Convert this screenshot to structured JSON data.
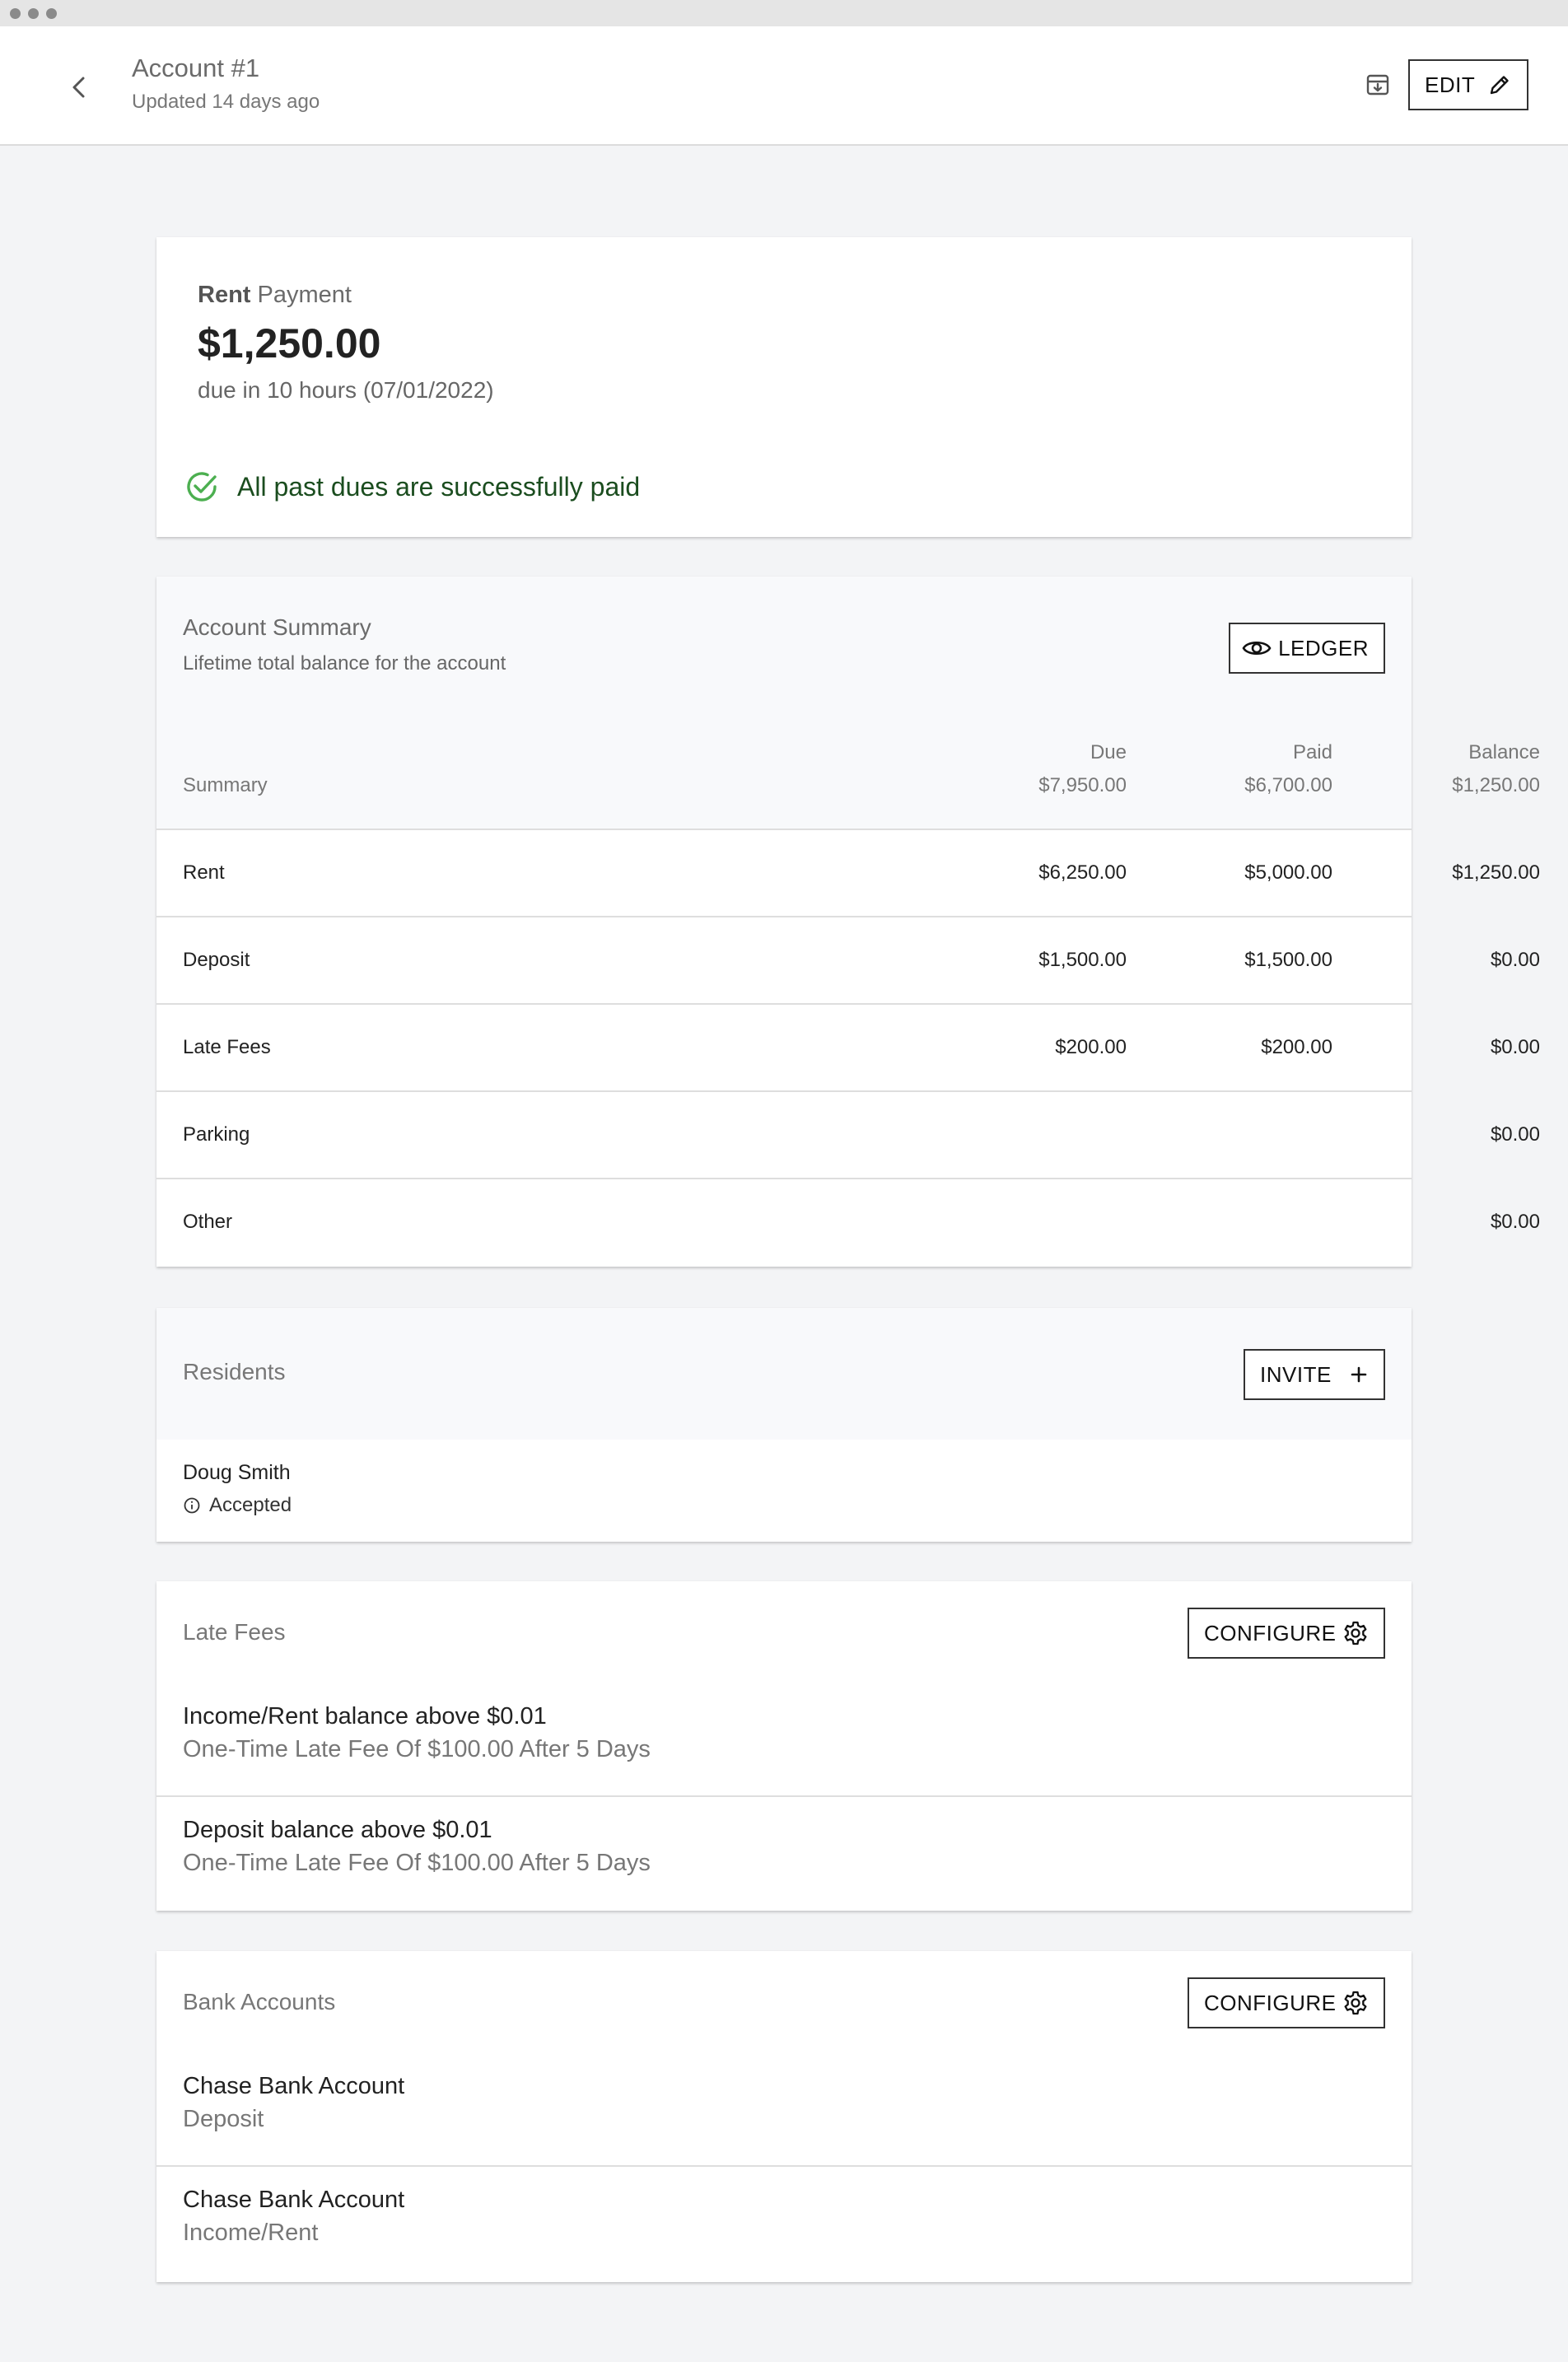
{
  "header": {
    "title": "Account #1",
    "updated": "Updated 14 days ago",
    "edit_label": "EDIT"
  },
  "payment": {
    "type_bold": "Rent",
    "type_rest": " Payment",
    "amount": "$1,250.00",
    "due": "due in 10 hours (07/01/2022)",
    "status": "All past dues are successfully paid"
  },
  "summary": {
    "title": "Account Summary",
    "subtitle": "Lifetime total balance for the account",
    "ledger_label": "LEDGER",
    "columns": {
      "summary": "Summary",
      "due": "Due",
      "paid": "Paid",
      "balance": "Balance"
    },
    "totals": {
      "due": "$7,950.00",
      "paid": "$6,700.00",
      "balance": "$1,250.00"
    },
    "rows": [
      {
        "label": "Rent",
        "due": "$6,250.00",
        "paid": "$5,000.00",
        "balance": "$1,250.00"
      },
      {
        "label": "Deposit",
        "due": "$1,500.00",
        "paid": "$1,500.00",
        "balance": "$0.00"
      },
      {
        "label": "Late Fees",
        "due": "$200.00",
        "paid": "$200.00",
        "balance": "$0.00"
      },
      {
        "label": "Parking",
        "due": "",
        "paid": "",
        "balance": "$0.00"
      },
      {
        "label": "Other",
        "due": "",
        "paid": "",
        "balance": "$0.00"
      }
    ]
  },
  "residents": {
    "title": "Residents",
    "invite_label": "INVITE",
    "items": [
      {
        "name": "Doug Smith",
        "status": "Accepted"
      }
    ]
  },
  "late_fees": {
    "title": "Late Fees",
    "configure_label": "CONFIGURE",
    "items": [
      {
        "title": "Income/Rent balance above $0.01",
        "subtitle": "One-Time Late Fee Of $100.00 After 5 Days"
      },
      {
        "title": "Deposit balance above $0.01",
        "subtitle": "One-Time Late Fee Of $100.00 After 5 Days"
      }
    ]
  },
  "bank_accounts": {
    "title": "Bank Accounts",
    "configure_label": "CONFIGURE",
    "items": [
      {
        "title": "Chase Bank Account",
        "subtitle": "Deposit"
      },
      {
        "title": "Chase Bank Account",
        "subtitle": "Income/Rent"
      }
    ]
  },
  "colors": {
    "success": "#4caf50",
    "success_text": "#1b4d1f",
    "background": "#f3f4f6"
  },
  "icons": [
    "back-icon",
    "archive-icon",
    "pencil-icon",
    "check-circle-icon",
    "eye-icon",
    "plus-icon",
    "info-icon",
    "gear-icon"
  ]
}
